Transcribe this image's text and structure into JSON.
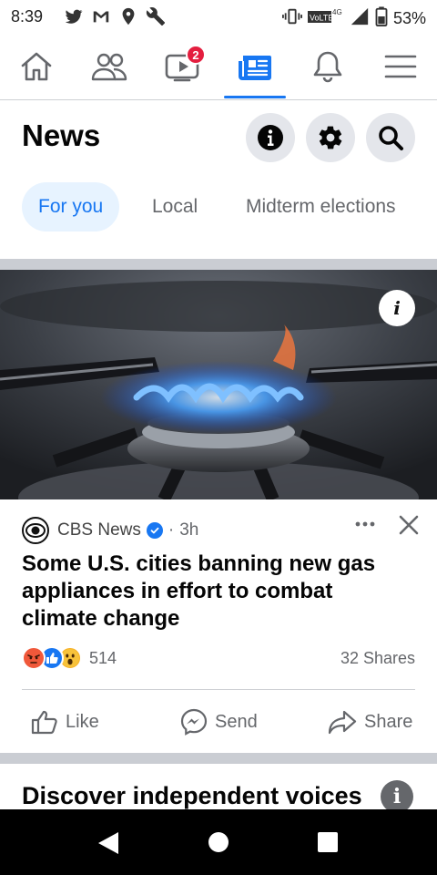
{
  "status_bar": {
    "time": "8:39",
    "battery_pct": "53%",
    "network_label": "VoLTE 4G",
    "icons": [
      "twitter-icon",
      "gmail-icon",
      "location-icon",
      "wrench-icon",
      "vibrate-icon",
      "signal-icon",
      "battery-icon"
    ]
  },
  "nav": {
    "tabs": [
      {
        "name": "home",
        "icon": "home-icon"
      },
      {
        "name": "friends",
        "icon": "friends-icon"
      },
      {
        "name": "watch",
        "icon": "watch-icon",
        "badge": "2"
      },
      {
        "name": "news",
        "icon": "news-icon",
        "active": true
      },
      {
        "name": "notifications",
        "icon": "bell-icon"
      },
      {
        "name": "menu",
        "icon": "menu-icon"
      }
    ]
  },
  "header": {
    "title": "News",
    "buttons": [
      "info-icon",
      "gear-icon",
      "search-icon"
    ]
  },
  "chips": [
    {
      "label": "For you",
      "active": true
    },
    {
      "label": "Local",
      "active": false
    },
    {
      "label": "Midterm elections",
      "active": false
    }
  ],
  "article": {
    "info_glyph": "i",
    "source": "CBS News",
    "dot": "·",
    "time": "3h",
    "headline": "Some U.S. cities banning new gas appliances in effort to combat climate change",
    "reactions": [
      "angry",
      "like",
      "wow"
    ],
    "reaction_count": "514",
    "shares": "32 Shares",
    "actions": {
      "like": "Like",
      "send": "Send",
      "share": "Share"
    }
  },
  "discover": {
    "title": "Discover independent voices",
    "info_glyph": "i"
  },
  "colors": {
    "accent": "#1877f2",
    "badge": "#e41e3f",
    "divider_band": "#cacdd3",
    "chip_active_bg": "#e7f3ff"
  }
}
